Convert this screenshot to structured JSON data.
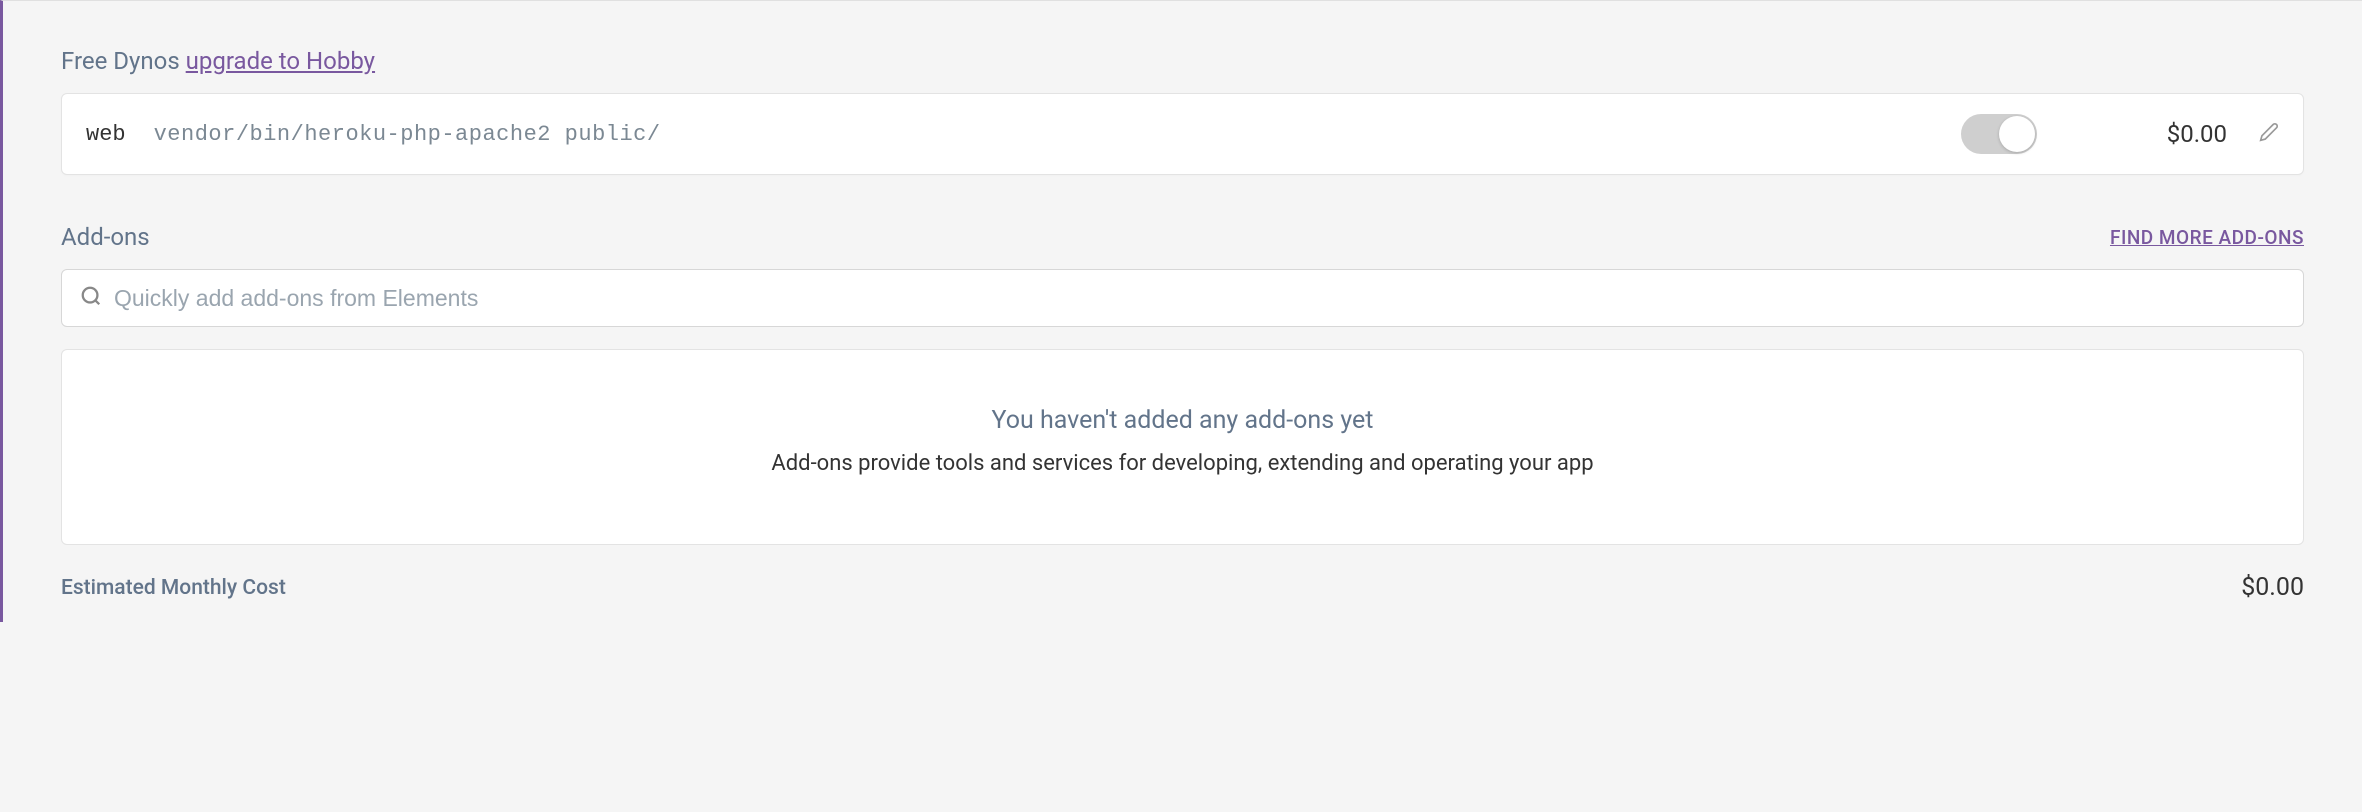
{
  "dynos": {
    "section_label": "Free Dynos",
    "upgrade_link": "upgrade to Hobby",
    "items": [
      {
        "type": "web",
        "command": "vendor/bin/heroku-php-apache2 public/",
        "price": "$0.00"
      }
    ]
  },
  "addons": {
    "section_label": "Add-ons",
    "find_more_label": "FIND MORE ADD-ONS",
    "search_placeholder": "Quickly add add-ons from Elements",
    "empty_title": "You haven't added any add-ons yet",
    "empty_desc": "Add-ons provide tools and services for developing, extending and operating your app"
  },
  "cost": {
    "label": "Estimated Monthly Cost",
    "value": "$0.00"
  }
}
